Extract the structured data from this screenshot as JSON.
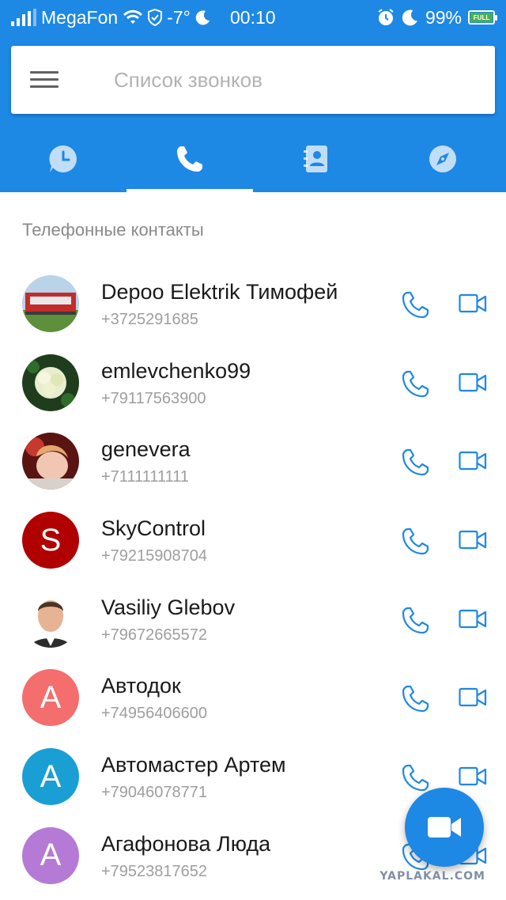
{
  "status_bar": {
    "carrier": "MegaFon",
    "temperature": "-7°",
    "time": "00:10",
    "battery_percent": "99%",
    "battery_label": "FULL",
    "signal_bars": 4
  },
  "app_bar": {
    "search_placeholder": "Список звонков",
    "tabs": [
      {
        "icon": "clock-icon",
        "selected": false
      },
      {
        "icon": "phone-icon",
        "selected": true
      },
      {
        "icon": "contacts-book-icon",
        "selected": false
      },
      {
        "icon": "compass-icon",
        "selected": false
      }
    ]
  },
  "section": {
    "title": "Телефонные контакты"
  },
  "contacts": [
    {
      "name": "Depoo Elektrik Тимофей",
      "phone": "+3725291685",
      "avatar": "photo",
      "photo_kind": "depoo"
    },
    {
      "name": "emlevchenko99",
      "phone": "+79117563900",
      "avatar": "photo",
      "photo_kind": "flower"
    },
    {
      "name": "genevera",
      "phone": "+7111111111",
      "avatar": "photo",
      "photo_kind": "woman"
    },
    {
      "name": "SkyControl",
      "phone": "+79215908704",
      "avatar": "letter",
      "letter": "S",
      "color": "#b00000"
    },
    {
      "name": "Vasiliy Glebov",
      "phone": "+79672665572",
      "avatar": "photo",
      "photo_kind": "man"
    },
    {
      "name": "Автодок",
      "phone": "+74956406600",
      "avatar": "letter",
      "letter": "A",
      "color": "#f46e6e"
    },
    {
      "name": "Автомастер Артем",
      "phone": "+79046078771",
      "avatar": "letter",
      "letter": "A",
      "color": "#1a9fd4"
    },
    {
      "name": "Агафонова Люда",
      "phone": "+79523817652",
      "avatar": "letter",
      "letter": "A",
      "color": "#b57ad6"
    }
  ],
  "colors": {
    "primary": "#1e88e5",
    "action_icon": "#1e88e5"
  },
  "watermark": "YAPLAKAL.COM"
}
